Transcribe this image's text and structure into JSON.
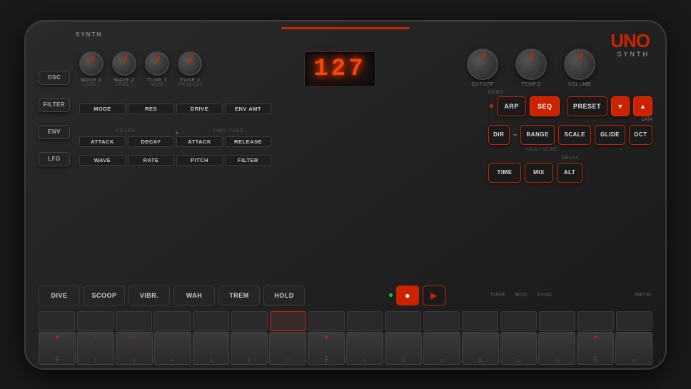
{
  "synth": {
    "title": "SYNTH",
    "logo": {
      "uno": "UNO",
      "synth": "SYNTH"
    },
    "display": {
      "value": "127"
    },
    "knobs": {
      "osc_row": [
        {
          "label": "WAVE 1",
          "sublabel": "LEVEL 1"
        },
        {
          "label": "WAVE 2",
          "sublabel": "LEVEL 2"
        },
        {
          "label": "TUNE 1",
          "sublabel": "NOISE"
        },
        {
          "label": "TUNE 2",
          "sublabel": "<HOLD:OSC"
        }
      ],
      "right_row": [
        {
          "label": "CUTOFF",
          "sublabel": ""
        },
        {
          "label": "TEMPO",
          "sublabel": ""
        },
        {
          "label": "VOLUME",
          "sublabel": ""
        }
      ]
    },
    "filter_row": [
      {
        "label": "MODE",
        "sublabel": ""
      },
      {
        "label": "RES",
        "sublabel": ""
      },
      {
        "label": "DRIVE",
        "sublabel": ""
      },
      {
        "label": "ENV AMT",
        "sublabel": ""
      }
    ],
    "env_row": {
      "filter_label": "FILTER",
      "amplitude_label": "AMPLITUDE",
      "params": [
        {
          "label": "ATTACK",
          "group": "filter"
        },
        {
          "label": "DECAY",
          "group": "filter"
        },
        {
          "label": "ATTACK",
          "group": "amplitude"
        },
        {
          "label": "RELEASE",
          "group": "amplitude"
        }
      ]
    },
    "lfo_row": [
      {
        "label": "WAVE"
      },
      {
        "label": "RATE"
      },
      {
        "label": "PITCH"
      },
      {
        "label": "FILTER"
      }
    ],
    "sections": {
      "osc": "OSC",
      "filter": "FILTER",
      "env": "ENV",
      "lfo": "LFO"
    },
    "buttons": {
      "arp": "ARP",
      "seq": "SEQ",
      "preset": "PRESET",
      "data_down": "▼",
      "data_up": "▲",
      "data_label": "DATA",
      "demo_label": "DEMO",
      "dir": "DIR",
      "range": "RANGE",
      "scale": "SCALE",
      "glide": "GLIDE",
      "oct": "OCT",
      "hold_store": "HOLD > STORE",
      "delay_label": "DELAY",
      "time": "TIME",
      "mix": "MIX",
      "alt": "ALT"
    },
    "fx_buttons": [
      {
        "label": "DIVE",
        "active": false
      },
      {
        "label": "SCOOP",
        "active": false
      },
      {
        "label": "VIBR.",
        "active": false
      },
      {
        "label": "WAH",
        "active": false
      },
      {
        "label": "TREM",
        "active": false
      },
      {
        "label": "HOLD",
        "active": false
      }
    ],
    "transport": {
      "rec": "●",
      "play": "▶"
    },
    "bottom_labels": [
      {
        "label": "TUNE"
      },
      {
        "label": "MIDI"
      },
      {
        "label": "SYNC"
      },
      {
        "label": "METR."
      }
    ],
    "piano_keys": [
      {
        "note": "C",
        "number": "1"
      },
      {
        "note": "",
        "number": "2"
      },
      {
        "note": "",
        "number": "3"
      },
      {
        "note": "",
        "number": "4"
      },
      {
        "note": "",
        "number": "5"
      },
      {
        "note": "",
        "number": "6"
      },
      {
        "note": "",
        "number": "7"
      },
      {
        "note": "",
        "number": "8"
      },
      {
        "note": "C",
        "number": "9"
      },
      {
        "note": "",
        "number": "10"
      },
      {
        "note": "",
        "number": "11"
      },
      {
        "note": "",
        "number": "12"
      },
      {
        "note": "",
        "number": "13"
      },
      {
        "note": "",
        "number": "14"
      },
      {
        "note": "C",
        "number": "15"
      },
      {
        "note": "",
        "number": "16"
      }
    ]
  }
}
